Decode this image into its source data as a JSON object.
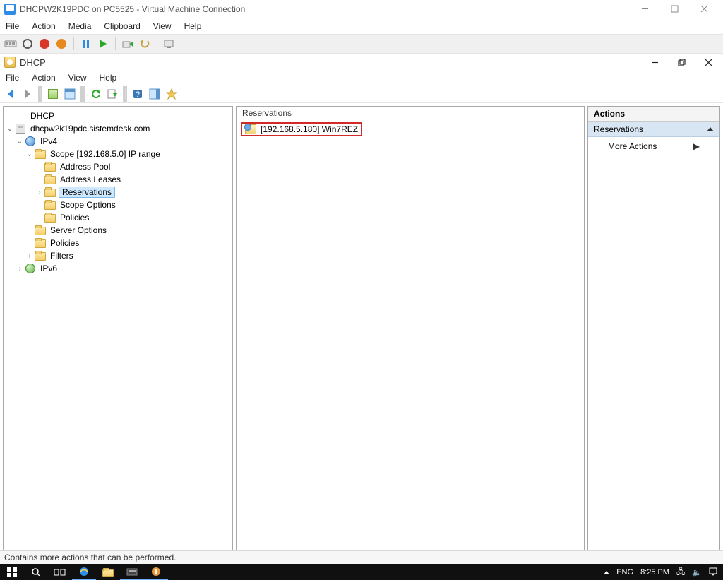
{
  "outer": {
    "title": "DHCPW2K19PDC on PC5525 - Virtual Machine Connection",
    "menu": [
      "File",
      "Action",
      "Media",
      "Clipboard",
      "View",
      "Help"
    ]
  },
  "inner": {
    "title": "DHCP",
    "menu": [
      "File",
      "Action",
      "View",
      "Help"
    ]
  },
  "tree": {
    "root": "DHCP",
    "server": "dhcpw2k19pdc.sistemdesk.com",
    "ipv4": "IPv4",
    "scope": "Scope [192.168.5.0] IP range",
    "addr_pool": "Address Pool",
    "addr_leases": "Address Leases",
    "reservations": "Reservations",
    "scope_opts": "Scope Options",
    "policies_scope": "Policies",
    "server_opts": "Server Options",
    "policies_srv": "Policies",
    "filters": "Filters",
    "ipv6": "IPv6"
  },
  "list": {
    "header": "Reservations",
    "item0": "[192.168.5.180] Win7REZ"
  },
  "actions": {
    "header": "Actions",
    "section": "Reservations",
    "more": "More Actions"
  },
  "status": "Contains more actions that can be performed.",
  "taskbar": {
    "lang": "ENG",
    "time": "8:25 PM"
  }
}
